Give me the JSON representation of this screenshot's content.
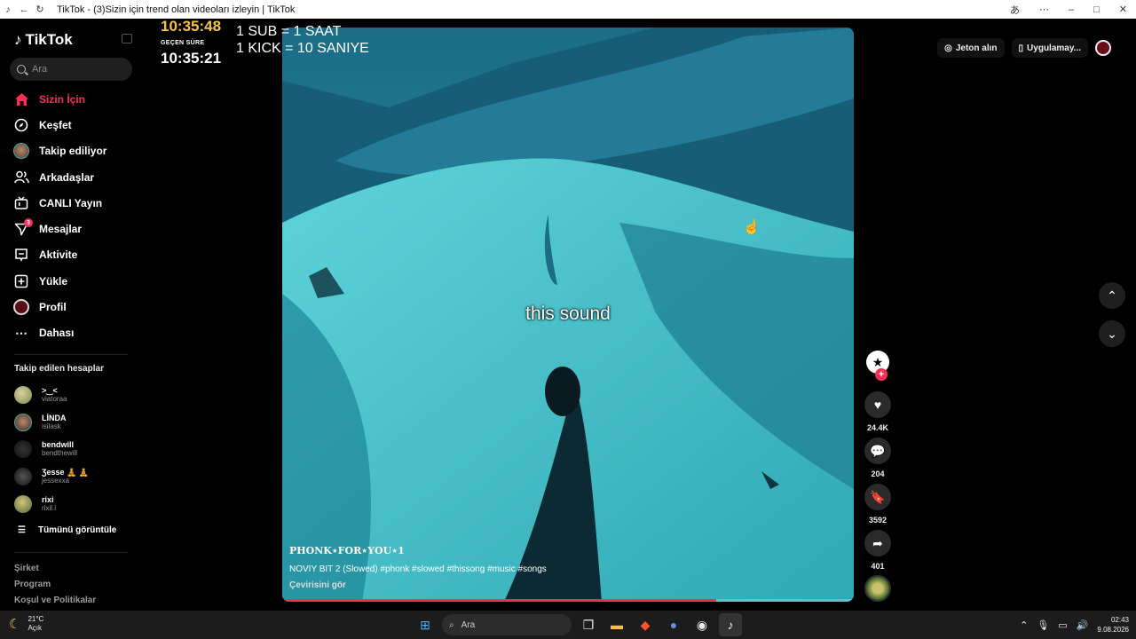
{
  "browser": {
    "title": "TikTok - (3)Sizin için trend olan videoları izleyin | TikTok"
  },
  "sidebar": {
    "brand": "TikTok",
    "search_placeholder": "Ara",
    "nav": [
      {
        "label": "Sizin İçin",
        "icon": "home-icon"
      },
      {
        "label": "Keşfet",
        "icon": "compass-icon"
      },
      {
        "label": "Takip ediliyor",
        "icon": "following-avatar-icon"
      },
      {
        "label": "Arkadaşlar",
        "icon": "friends-icon"
      },
      {
        "label": "CANLI Yayın",
        "icon": "live-tv-icon"
      },
      {
        "label": "Mesajlar",
        "icon": "messages-icon",
        "badge": "3"
      },
      {
        "label": "Aktivite",
        "icon": "activity-icon"
      },
      {
        "label": "Yükle",
        "icon": "upload-icon"
      },
      {
        "label": "Profil",
        "icon": "profile-icon"
      },
      {
        "label": "Dahası",
        "icon": "more-icon"
      }
    ],
    "following_title": "Takip edilen hesaplar",
    "following": [
      {
        "name": ">‿<",
        "user": "viatoraa"
      },
      {
        "name": "LİNDA",
        "user": "isilask"
      },
      {
        "name": "bendwill",
        "user": "bendthewill"
      },
      {
        "name": "Ʒesse 🧘 🧘",
        "user": "jessexxa"
      },
      {
        "name": "rixi",
        "user": "rixil.l"
      }
    ],
    "see_all": "Tümünü görüntüle",
    "footer": [
      "Şirket",
      "Program",
      "Koşul ve Politikalar"
    ]
  },
  "overlay": {
    "timer_top": "10:35:48",
    "elapsed_label": "GEÇEN SÜRE",
    "timer_bottom": "10:35:21",
    "rule1": "1 SUB = 1 SAAT",
    "rule2": "1 KICK = 10 SANIYE"
  },
  "video": {
    "caption": "this sound",
    "author": "PHONK⋆FOR⋆YOU⋆1",
    "description": "NOVIY BIT 2 (Slowed) #phonk #slowed #thissong #music #songs",
    "translate": "Çevirisini gör",
    "progress": 0.76
  },
  "actions": {
    "likes": "24.4K",
    "comments": "204",
    "saves": "3592",
    "shares": "401"
  },
  "topbar": {
    "coins": "Jeton alın",
    "app": "Uygulamay..."
  },
  "taskbar": {
    "temp": "21°C",
    "condition": "Açık",
    "search": "Ara",
    "time": "02:43",
    "date": "9.08.2026"
  }
}
